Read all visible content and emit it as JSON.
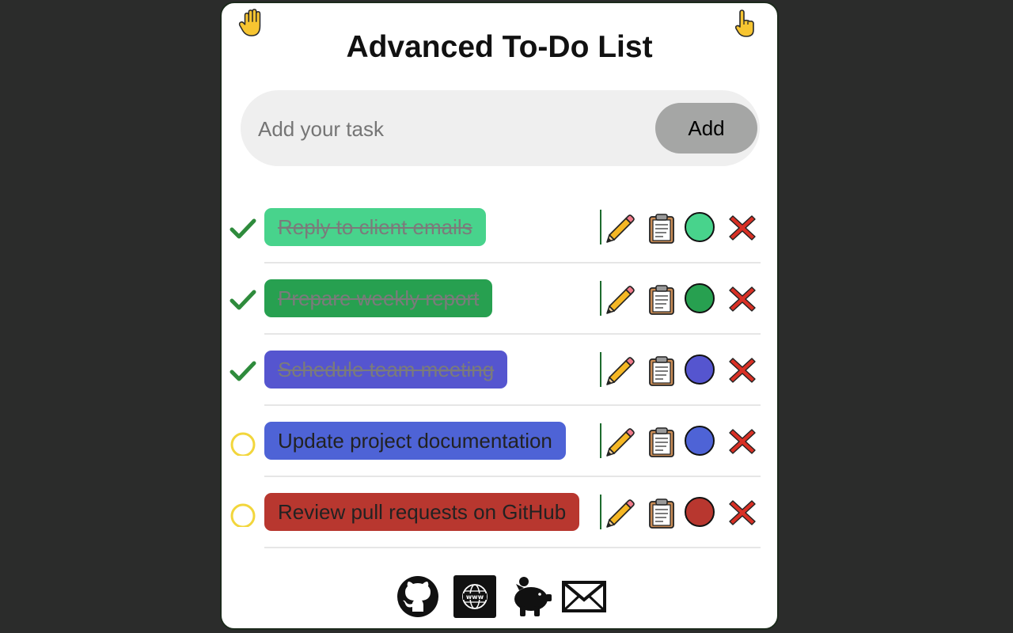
{
  "app": {
    "title": "Advanced To-Do List"
  },
  "add_form": {
    "placeholder": "Add your task",
    "add_label": "Add"
  },
  "tasks": [
    {
      "label": "Reply to client emails",
      "completed": true,
      "color": "#48d38c"
    },
    {
      "label": "Prepare weekly report",
      "completed": true,
      "color": "#27a050"
    },
    {
      "label": "Schedule team meeting",
      "completed": true,
      "color": "#5555cf"
    },
    {
      "label": "Update project documentation",
      "completed": false,
      "color": "#4e63d6"
    },
    {
      "label": "Review pull requests on GitHub",
      "completed": false,
      "color": "#b8372f"
    }
  ],
  "icons": {
    "header": [
      "hand-icon",
      "pointer-icon"
    ],
    "task_actions": [
      "edit-icon",
      "copy-icon",
      "color-dot",
      "delete-icon"
    ],
    "footer": [
      "github-icon",
      "website-icon",
      "piggy-bank-icon",
      "mail-icon"
    ]
  },
  "colors": {
    "checkmark": "#2e8b3c",
    "pending_circle": "#f2d63c",
    "delete": "#d93025"
  }
}
